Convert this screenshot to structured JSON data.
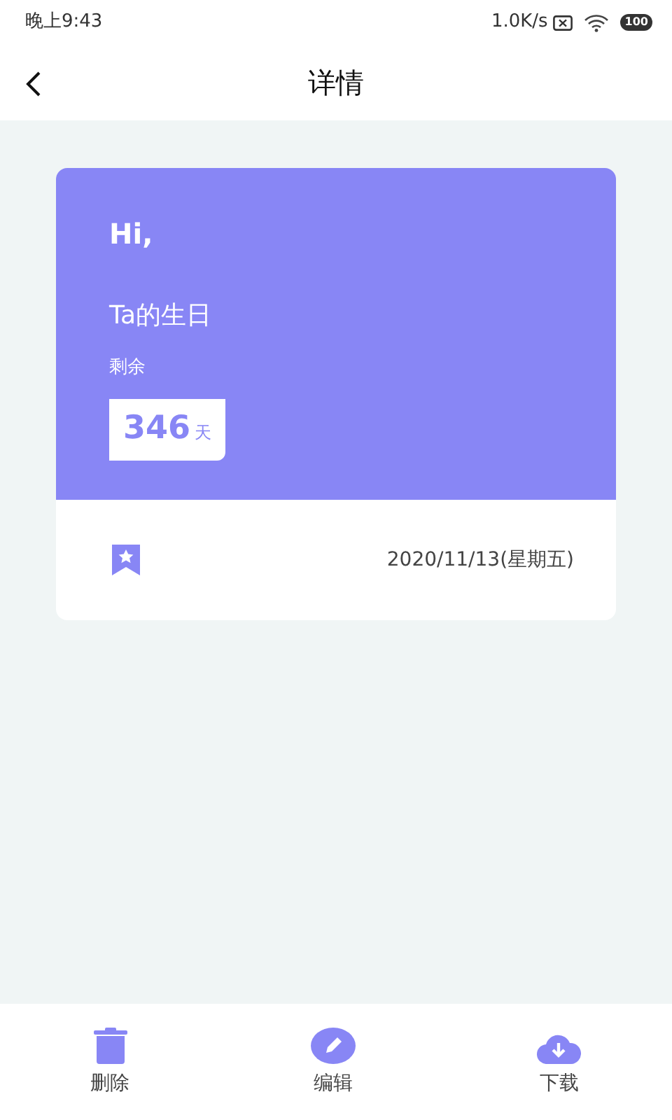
{
  "status_bar": {
    "time": "晚上9:43",
    "speed": "1.0K/s",
    "battery": "100"
  },
  "header": {
    "title": "详情"
  },
  "card": {
    "greeting": "Hi,",
    "event": "Ta的生日",
    "remaining_label": "剩余",
    "days": "346",
    "unit": "天",
    "date": "2020/11/13(星期五)"
  },
  "actions": [
    {
      "kind": "delete",
      "label": "删除"
    },
    {
      "kind": "edit",
      "label": "编辑"
    },
    {
      "kind": "download",
      "label": "下载"
    }
  ]
}
